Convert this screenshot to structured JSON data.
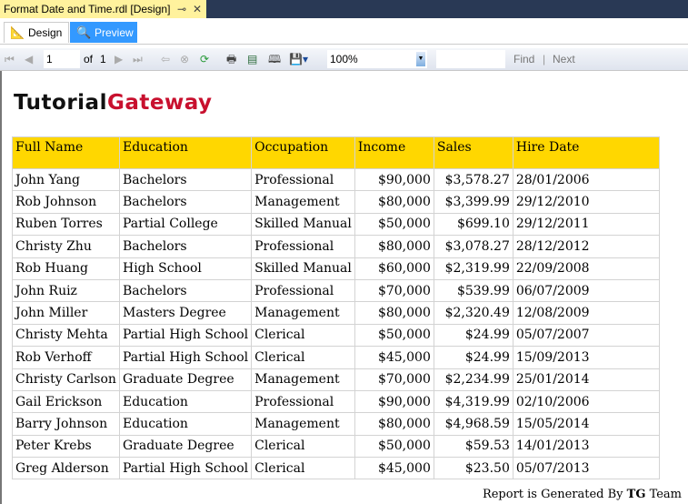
{
  "window": {
    "doc_tab": "Format Date and Time.rdl [Design]",
    "pin": "⊸",
    "close": "✕"
  },
  "view_tabs": [
    {
      "label": "Design"
    },
    {
      "label": "Preview"
    }
  ],
  "toolbar": {
    "page": "1",
    "of_label": "of",
    "total_pages": "1",
    "zoom": "100%",
    "find": "Find",
    "separator": "|",
    "next": "Next"
  },
  "logo": {
    "part1": "Tutorial",
    "part2": "Gateway"
  },
  "table": {
    "headers": [
      "Full Name",
      "Education",
      "Occupation",
      "Income",
      "Sales",
      "Hire Date"
    ],
    "rows": [
      [
        "John Yang",
        "Bachelors",
        "Professional",
        "$90,000",
        "$3,578.27",
        "28/01/2006"
      ],
      [
        "Rob Johnson",
        "Bachelors",
        "Management",
        "$80,000",
        "$3,399.99",
        "29/12/2010"
      ],
      [
        "Ruben Torres",
        "Partial College",
        "Skilled Manual",
        "$50,000",
        "$699.10",
        "29/12/2011"
      ],
      [
        "Christy Zhu",
        "Bachelors",
        "Professional",
        "$80,000",
        "$3,078.27",
        "28/12/2012"
      ],
      [
        "Rob Huang",
        "High School",
        "Skilled Manual",
        "$60,000",
        "$2,319.99",
        "22/09/2008"
      ],
      [
        "John Ruiz",
        "Bachelors",
        "Professional",
        "$70,000",
        "$539.99",
        "06/07/2009"
      ],
      [
        "John Miller",
        "Masters Degree",
        "Management",
        "$80,000",
        "$2,320.49",
        "12/08/2009"
      ],
      [
        "Christy Mehta",
        "Partial High School",
        "Clerical",
        "$50,000",
        "$24.99",
        "05/07/2007"
      ],
      [
        "Rob Verhoff",
        "Partial High School",
        "Clerical",
        "$45,000",
        "$24.99",
        "15/09/2013"
      ],
      [
        "Christy Carlson",
        "Graduate Degree",
        "Management",
        "$70,000",
        "$2,234.99",
        "25/01/2014"
      ],
      [
        "Gail Erickson",
        "Education",
        "Professional",
        "$90,000",
        "$4,319.99",
        "02/10/2006"
      ],
      [
        "Barry Johnson",
        "Education",
        "Management",
        "$80,000",
        "$4,968.59",
        "15/05/2014"
      ],
      [
        "Peter Krebs",
        "Graduate Degree",
        "Clerical",
        "$50,000",
        "$59.53",
        "14/01/2013"
      ],
      [
        "Greg Alderson",
        "Partial High School",
        "Clerical",
        "$45,000",
        "$23.50",
        "05/07/2013"
      ]
    ]
  },
  "footer": {
    "prefix": "Report is Generated By",
    "bold": "TG",
    "suffix": "Team"
  }
}
